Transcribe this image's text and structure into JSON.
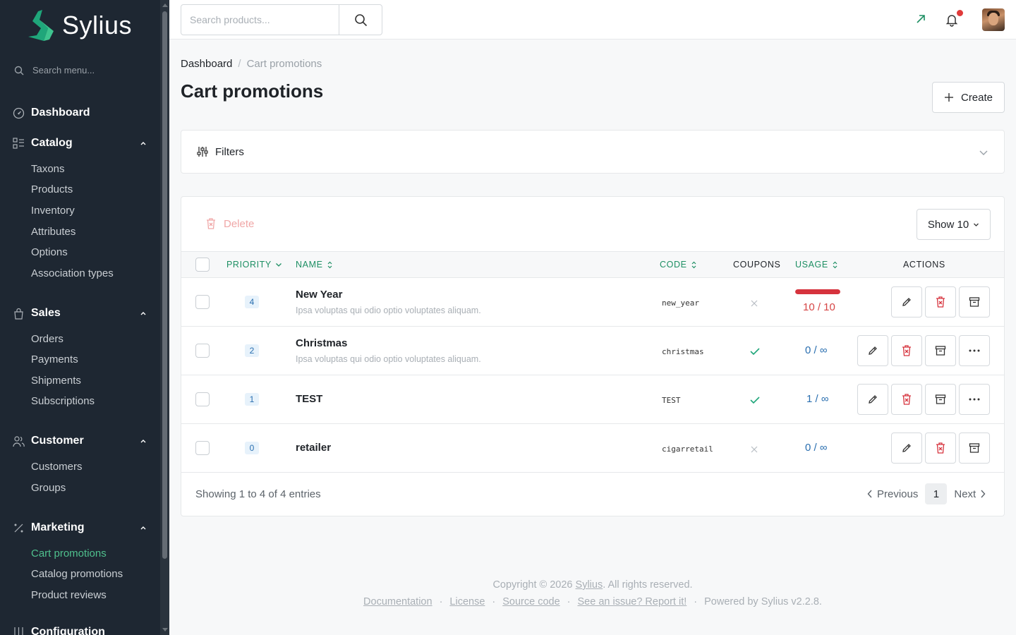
{
  "brand": {
    "name": "Sylius"
  },
  "sidebar": {
    "search_placeholder": "Search menu...",
    "dashboard": "Dashboard",
    "catalog": {
      "label": "Catalog",
      "items": [
        "Taxons",
        "Products",
        "Inventory",
        "Attributes",
        "Options",
        "Association types"
      ]
    },
    "sales": {
      "label": "Sales",
      "items": [
        "Orders",
        "Payments",
        "Shipments",
        "Subscriptions"
      ]
    },
    "customer": {
      "label": "Customer",
      "items": [
        "Customers",
        "Groups"
      ]
    },
    "marketing": {
      "label": "Marketing",
      "items": [
        "Cart promotions",
        "Catalog promotions",
        "Product reviews"
      ],
      "active": "Cart promotions"
    },
    "configuration": {
      "label": "Configuration"
    }
  },
  "topbar": {
    "search_placeholder": "Search products..."
  },
  "breadcrumb": {
    "home": "Dashboard",
    "separator": "/",
    "current": "Cart promotions"
  },
  "page": {
    "title": "Cart promotions",
    "create_label": "Create"
  },
  "filters": {
    "label": "Filters"
  },
  "grid": {
    "delete_label": "Delete",
    "show_label": "Show 10",
    "columns": {
      "priority": "PRIORITY",
      "name": "NAME",
      "code": "CODE",
      "coupons": "COUPONS",
      "usage": "USAGE",
      "actions": "ACTIONS"
    },
    "rows": [
      {
        "priority": "4",
        "name": "New Year",
        "description": "Ipsa voluptas qui odio optio voluptates aliquam.",
        "code": "new_year",
        "coupons": false,
        "usage": "10 / 10",
        "usage_fraction": 1.0,
        "more": false
      },
      {
        "priority": "2",
        "name": "Christmas",
        "description": "Ipsa voluptas qui odio optio voluptates aliquam.",
        "code": "christmas",
        "coupons": true,
        "usage": "0 / ∞",
        "usage_fraction": null,
        "more": true
      },
      {
        "priority": "1",
        "name": "TEST",
        "description": "",
        "code": "TEST",
        "coupons": true,
        "usage": "1 / ∞",
        "usage_fraction": null,
        "more": true
      },
      {
        "priority": "0",
        "name": "retailer",
        "description": "",
        "code": "cigarretail",
        "coupons": false,
        "usage": "0 / ∞",
        "usage_fraction": null,
        "more": false
      }
    ],
    "showing": "Showing 1 to 4 of 4 entries",
    "pagination": {
      "previous": "Previous",
      "page": "1",
      "next": "Next"
    }
  },
  "footer": {
    "copyright_prefix": "Copyright © 2026 ",
    "copyright_link": "Sylius",
    "copyright_suffix": ". All rights reserved.",
    "links": [
      "Documentation",
      "License",
      "Source code",
      "See an issue? Report it!"
    ],
    "powered": "Powered by Sylius v2.2.8."
  },
  "colors": {
    "sidebar_bg": "#1e2732",
    "accent_green": "#1d8f63",
    "active_menu": "#4fc08d",
    "danger": "#d6333d",
    "usage_blue": "#2a6fb0"
  },
  "icons": [
    "sylius-logo",
    "search-icon",
    "dashboard-icon",
    "catalog-icon",
    "sales-icon",
    "customer-icon",
    "marketing-icon",
    "configuration-icon",
    "external-link-icon",
    "bell-icon",
    "plus-icon",
    "filters-icon",
    "chevron-down-icon",
    "trash-icon",
    "edit-icon",
    "archive-icon",
    "more-icon",
    "check-icon",
    "x-icon"
  ]
}
